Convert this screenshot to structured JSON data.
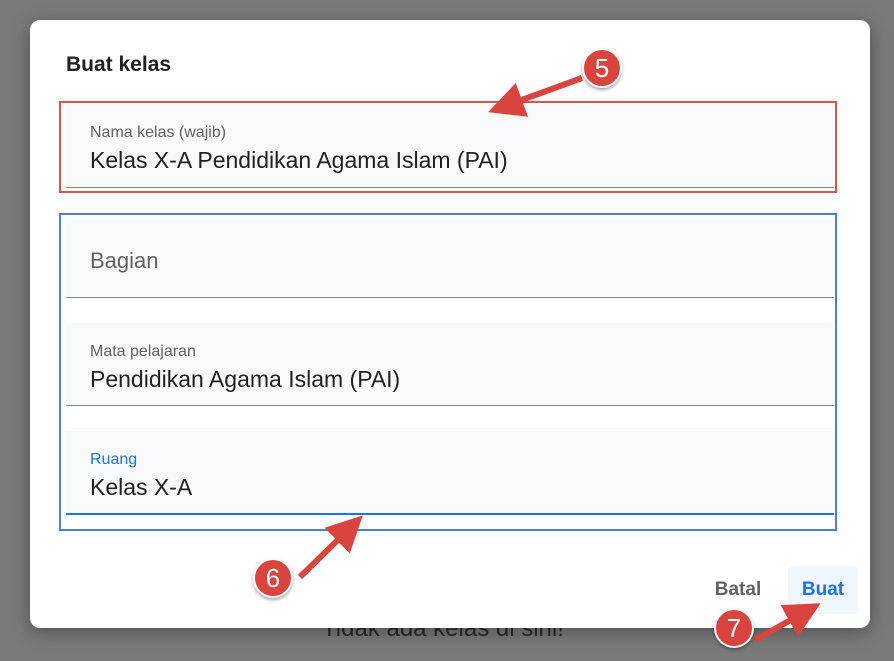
{
  "backdrop": {
    "text": "Tidak ada kelas di sini!"
  },
  "dialog": {
    "title": "Buat kelas",
    "fields": {
      "class_name": {
        "label": "Nama kelas (wajib)",
        "value": "Kelas X-A Pendidikan Agama Islam (PAI)"
      },
      "section": {
        "placeholder": "Bagian"
      },
      "subject": {
        "label": "Mata pelajaran",
        "value": "Pendidikan Agama Islam (PAI)"
      },
      "room": {
        "label": "Ruang",
        "value": "Kelas X-A"
      }
    },
    "buttons": {
      "cancel": "Batal",
      "create": "Buat"
    }
  },
  "annotations": {
    "step_5": "5",
    "step_6": "6",
    "step_7": "7"
  },
  "colors": {
    "accent": "#1a73e8",
    "marker_red": "#d9453e",
    "box_red": "#d9534f",
    "box_blue": "#4a7fd4"
  }
}
